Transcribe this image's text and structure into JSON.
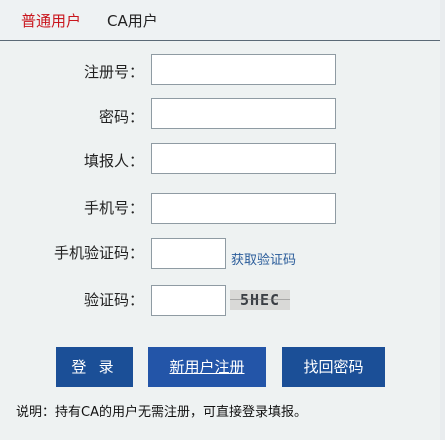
{
  "tabs": {
    "normal_user": "普通用户",
    "ca_user": "CA用户"
  },
  "form": {
    "registration_no_label": "注册号：",
    "password_label": "密码：",
    "filer_label": "填报人：",
    "phone_label": "手机号：",
    "sms_code_label": "手机验证码：",
    "sms_code_link": "获取验证码",
    "captcha_label": "验证码：",
    "captcha_text": "5HEC",
    "registration_no_value": "",
    "password_value": "",
    "filer_value": "",
    "phone_value": "",
    "sms_code_value": "",
    "captcha_value": ""
  },
  "buttons": {
    "login": "登 录",
    "register": "新用户注册",
    "recover_password": "找回密码"
  },
  "note": "说明：持有CA的用户无需注册，可直接登录填报。",
  "colors": {
    "active_tab": "#c9161d",
    "button_bg": "#1b4f97",
    "link": "#2a5c9a"
  }
}
